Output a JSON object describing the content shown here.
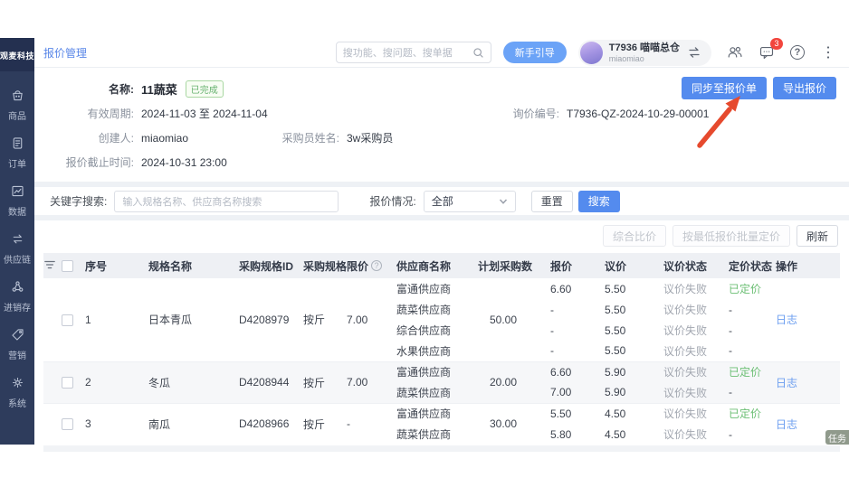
{
  "palette": {
    "sidebar_navy": "#2e3c5c",
    "accent_blue": "#548bee",
    "light_blue_pill": "#6ba3f7",
    "success_green": "#67b26f",
    "danger_red": "#f2453d",
    "link_blue": "#6d9ff0",
    "annotation_arrow_red": "#e64a2e"
  },
  "sidebar": {
    "logo": "观麦科技",
    "items": [
      {
        "label": "商品",
        "icon": "basket"
      },
      {
        "label": "订单",
        "icon": "order"
      },
      {
        "label": "数据",
        "icon": "chart"
      },
      {
        "label": "供应链",
        "icon": "supply"
      },
      {
        "label": "进销存",
        "icon": "inventory"
      },
      {
        "label": "营销",
        "icon": "tag"
      },
      {
        "label": "系统",
        "icon": "gear"
      }
    ]
  },
  "topbar": {
    "breadcrumb": "报价管理",
    "search_placeholder": "搜功能、搜问题、搜单据",
    "guide_button": "新手引导",
    "user": {
      "name": "T7936 喵喵总仓",
      "account": "miaomiao"
    },
    "notification_count": "3",
    "help_glyph": "?"
  },
  "info": {
    "name_label": "名称:",
    "name_value": "11蔬菜",
    "status_badge": "已完成",
    "period_label": "有效周期:",
    "period_value": "2024-11-03 至 2024-11-04",
    "quote_no_label": "询价编号:",
    "quote_no_value": "T7936-QZ-2024-10-29-00001",
    "creator_label": "创建人:",
    "creator_value": "miaomiao",
    "buyer_label": "采购员姓名:",
    "buyer_value": "3w采购员",
    "deadline_label": "报价截止时间:",
    "deadline_value": "2024-10-31 23:00"
  },
  "page_actions": {
    "sync": "同步至报价单",
    "export": "导出报价"
  },
  "filters": {
    "keyword_label": "关键字搜索:",
    "keyword_placeholder": "输入规格名称、供应商名称搜索",
    "status_label": "报价情况:",
    "status_value": "全部",
    "reset": "重置",
    "search": "搜索"
  },
  "table_actions": {
    "compare": "综合比价",
    "batch_price": "按最低报价批量定价",
    "refresh": "刷新"
  },
  "table": {
    "headers": [
      "序号",
      "规格名称",
      "采购规格ID",
      "采购规格",
      "限价",
      "供应商名称",
      "计划采购数",
      "报价",
      "议价",
      "议价状态",
      "定价状态",
      "操作"
    ],
    "rows": [
      {
        "seq": "1",
        "name": "日本青瓜",
        "spec_id": "D4208979",
        "spec": "按斤",
        "limit": "7.00",
        "plan": "50.00",
        "log": "日志",
        "suppliers": [
          {
            "name": "富通供应商",
            "quote": "6.60",
            "bargain": "5.50",
            "bargain_status": "议价失败",
            "price_status": "已定价",
            "priced": true
          },
          {
            "name": "蔬菜供应商",
            "quote": "-",
            "bargain": "5.50",
            "bargain_status": "议价失败",
            "price_status": "-",
            "priced": false
          },
          {
            "name": "综合供应商",
            "quote": "-",
            "bargain": "5.50",
            "bargain_status": "议价失败",
            "price_status": "-",
            "priced": false
          },
          {
            "name": "水果供应商",
            "quote": "-",
            "bargain": "5.50",
            "bargain_status": "议价失败",
            "price_status": "-",
            "priced": false
          }
        ]
      },
      {
        "seq": "2",
        "name": "冬瓜",
        "spec_id": "D4208944",
        "spec": "按斤",
        "limit": "7.00",
        "plan": "20.00",
        "log": "日志",
        "suppliers": [
          {
            "name": "富通供应商",
            "quote": "6.60",
            "bargain": "5.90",
            "bargain_status": "议价失败",
            "price_status": "已定价",
            "priced": true
          },
          {
            "name": "蔬菜供应商",
            "quote": "7.00",
            "bargain": "5.90",
            "bargain_status": "议价失败",
            "price_status": "-",
            "priced": false
          }
        ]
      },
      {
        "seq": "3",
        "name": "南瓜",
        "spec_id": "D4208966",
        "spec": "按斤",
        "limit": "-",
        "plan": "30.00",
        "log": "日志",
        "suppliers": [
          {
            "name": "富通供应商",
            "quote": "5.50",
            "bargain": "4.50",
            "bargain_status": "议价失败",
            "price_status": "已定价",
            "priced": true
          },
          {
            "name": "蔬菜供应商",
            "quote": "5.80",
            "bargain": "4.50",
            "bargain_status": "议价失败",
            "price_status": "-",
            "priced": false
          }
        ]
      }
    ]
  },
  "task_tag": "任务"
}
